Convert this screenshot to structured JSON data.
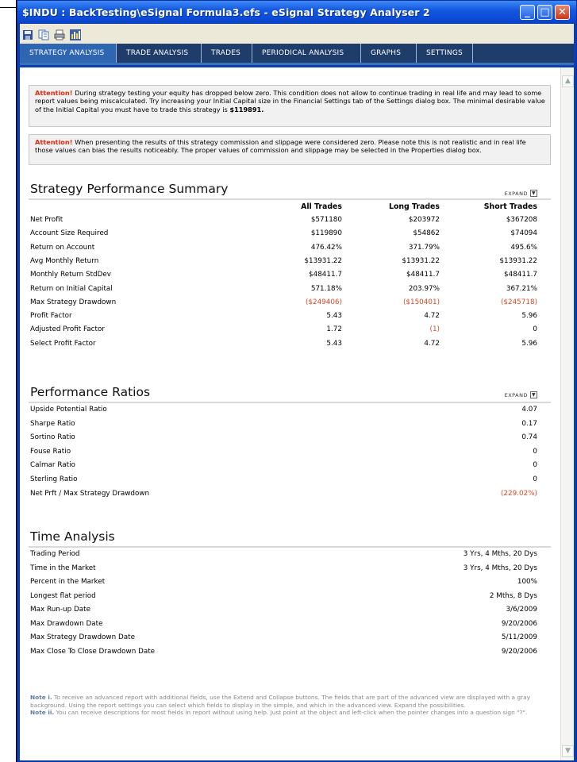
{
  "window": {
    "title": "$INDU : BackTesting\\eSignal Formula3.efs - eSignal Strategy Analyser 2",
    "minimize": "_",
    "maximize": "□",
    "close": "✕"
  },
  "toolbar": {
    "icons": [
      "save-icon",
      "copy-icon",
      "print-icon",
      "chart-icon"
    ]
  },
  "tabs": [
    "STRATEGY ANALYSIS",
    "TRADE ANALYSIS",
    "TRADES",
    "PERIODICAL ANALYSIS",
    "GRAPHS",
    "SETTINGS"
  ],
  "attention": [
    {
      "prefix": "Attention!",
      "text": " During strategy testing your equity has dropped below zero. This condition does not allow to continue trading in real life and may lead to some report values being miscalculated. Try increasing your Initial Capital size in the Financial Settings tab of the Settings dialog box. The minimal desirable value of the Initial Capital you must have to trade this strategy is ",
      "bold_tail": "$119891."
    },
    {
      "prefix": "Attention!",
      "text": " When presenting the results of this strategy commission and slippage were considered zero. Please note this is not realistic and in real life those values can bias the results noticeably. The proper values of commission and slippage may be selected in the Properties dialog box.",
      "bold_tail": ""
    }
  ],
  "expand_label": "EXPAND",
  "summary": {
    "title": "Strategy Performance Summary",
    "columns": [
      "All Trades",
      "Long Trades",
      "Short Trades"
    ],
    "rows": [
      {
        "label": "Net Profit",
        "values": [
          "$571180",
          "$203972",
          "$367208"
        ],
        "red": [
          false,
          false,
          false
        ]
      },
      {
        "label": "Account Size Required",
        "values": [
          "$119890",
          "$54862",
          "$74094"
        ],
        "red": [
          false,
          false,
          false
        ]
      },
      {
        "label": "Return on Account",
        "values": [
          "476.42%",
          "371.79%",
          "495.6%"
        ],
        "red": [
          false,
          false,
          false
        ]
      },
      {
        "label": "Avg Monthly Return",
        "values": [
          "$13931.22",
          "$13931.22",
          "$13931.22"
        ],
        "red": [
          false,
          false,
          false
        ]
      },
      {
        "label": "Monthly Return StdDev",
        "values": [
          "$48411.7",
          "$48411.7",
          "$48411.7"
        ],
        "red": [
          false,
          false,
          false
        ]
      },
      {
        "label": "Return on Initial Capital",
        "values": [
          "571.18%",
          "203.97%",
          "367.21%"
        ],
        "red": [
          false,
          false,
          false
        ]
      },
      {
        "label": "Max Strategy Drawdown",
        "values": [
          "($249406)",
          "($150401)",
          "($245718)"
        ],
        "red": [
          true,
          true,
          true
        ]
      },
      {
        "label": "Profit Factor",
        "values": [
          "5.43",
          "4.72",
          "5.96"
        ],
        "red": [
          false,
          false,
          false
        ]
      },
      {
        "label": "Adjusted Profit Factor",
        "values": [
          "1.72",
          "(1)",
          "0"
        ],
        "red": [
          false,
          true,
          false
        ]
      },
      {
        "label": "Select Profit Factor",
        "values": [
          "5.43",
          "4.72",
          "5.96"
        ],
        "red": [
          false,
          false,
          false
        ]
      }
    ]
  },
  "ratios": {
    "title": "Performance Ratios",
    "rows": [
      {
        "label": "Upside Potential Ratio",
        "value": "4.07",
        "red": false
      },
      {
        "label": "Sharpe Ratio",
        "value": "0.17",
        "red": false
      },
      {
        "label": "Sortino Ratio",
        "value": "0.74",
        "red": false
      },
      {
        "label": "Fouse Ratio",
        "value": "0",
        "red": false
      },
      {
        "label": "Calmar Ratio",
        "value": "0",
        "red": false
      },
      {
        "label": "Sterling Ratio",
        "value": "0",
        "red": false
      },
      {
        "label": "Net Prft / Max Strategy Drawdown",
        "value": "(229.02%)",
        "red": true
      }
    ]
  },
  "time": {
    "title": "Time Analysis",
    "rows": [
      {
        "label": "Trading Period",
        "value": "3 Yrs, 4 Mths, 20 Dys"
      },
      {
        "label": "Time in the Market",
        "value": "3 Yrs, 4 Mths, 20 Dys"
      },
      {
        "label": "Percent in the Market",
        "value": "100%"
      },
      {
        "label": "Longest flat period",
        "value": "2 Mths, 8 Dys"
      },
      {
        "label": "Max Run-up Date",
        "value": "3/6/2009"
      },
      {
        "label": "Max Drawdown Date",
        "value": "9/20/2006"
      },
      {
        "label": "Max Strategy Drawdown Date",
        "value": "5/11/2009"
      },
      {
        "label": "Max Close To Close Drawdown Date",
        "value": "9/20/2006"
      }
    ]
  },
  "notes": [
    {
      "prefix": "Note i.",
      "text": " To receive an advanced report with additional fields, use the Extend and Collapse buttons. The fields that are part of the advanced view are displayed with a gray background. Using the report settings you can select which fields to display in the simple, and which in the advanced view. Expand the possibilities."
    },
    {
      "prefix": "Note ii.",
      "text": " You can receive descriptions for most fields in report without using help. Just point at the object and left-click when the pointer changes into a question sign \"?\"."
    }
  ]
}
